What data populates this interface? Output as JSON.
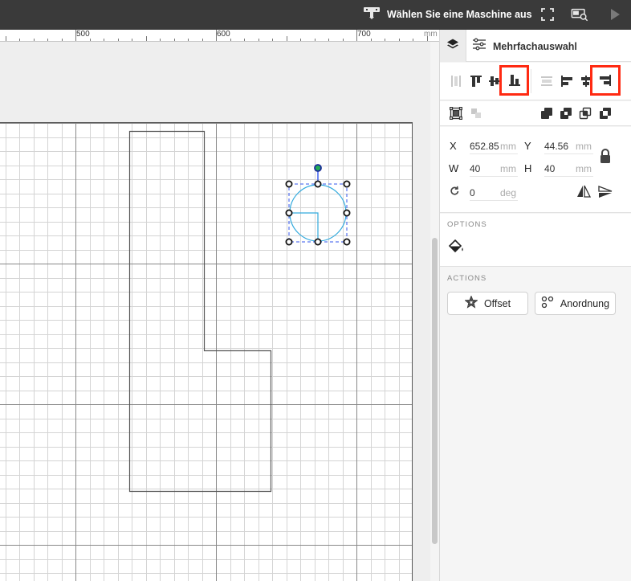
{
  "topbar": {
    "machine_label": "Wählen Sie eine Maschine aus",
    "icons": [
      "machine-icon",
      "fullscreen-icon",
      "camera-preview-icon",
      "play-icon"
    ]
  },
  "ruler": {
    "labels": [
      "500",
      "600",
      "700",
      "mm"
    ]
  },
  "panel": {
    "title": "Mehrfachauswahl",
    "align_tools": [
      "align-vertical-distribute-icon",
      "align-top-icon",
      "align-vertical-center-icon",
      "align-bottom-icon",
      "align-horizontal-distribute-icon",
      "align-left-icon",
      "align-horizontal-center-icon",
      "align-right-icon"
    ],
    "highlighted": [
      "align-bottom-icon",
      "align-right-icon"
    ],
    "transform": {
      "x_label": "X",
      "x_value": "652.85",
      "x_unit": "mm",
      "y_label": "Y",
      "y_value": "44.56",
      "y_unit": "mm",
      "w_label": "W",
      "w_value": "40",
      "w_unit": "mm",
      "h_label": "H",
      "h_value": "40",
      "h_unit": "mm",
      "rotation_value": "0",
      "rotation_unit": "deg"
    },
    "options_title": "OPTIONS",
    "actions_title": "ACTIONS",
    "offset_label": "Offset",
    "arrange_label": "Anordnung"
  },
  "colors": {
    "topbar": "#3a3a3a",
    "highlight": "#ff2a12",
    "selection": "#3355ee",
    "circle": "#33aadd"
  }
}
